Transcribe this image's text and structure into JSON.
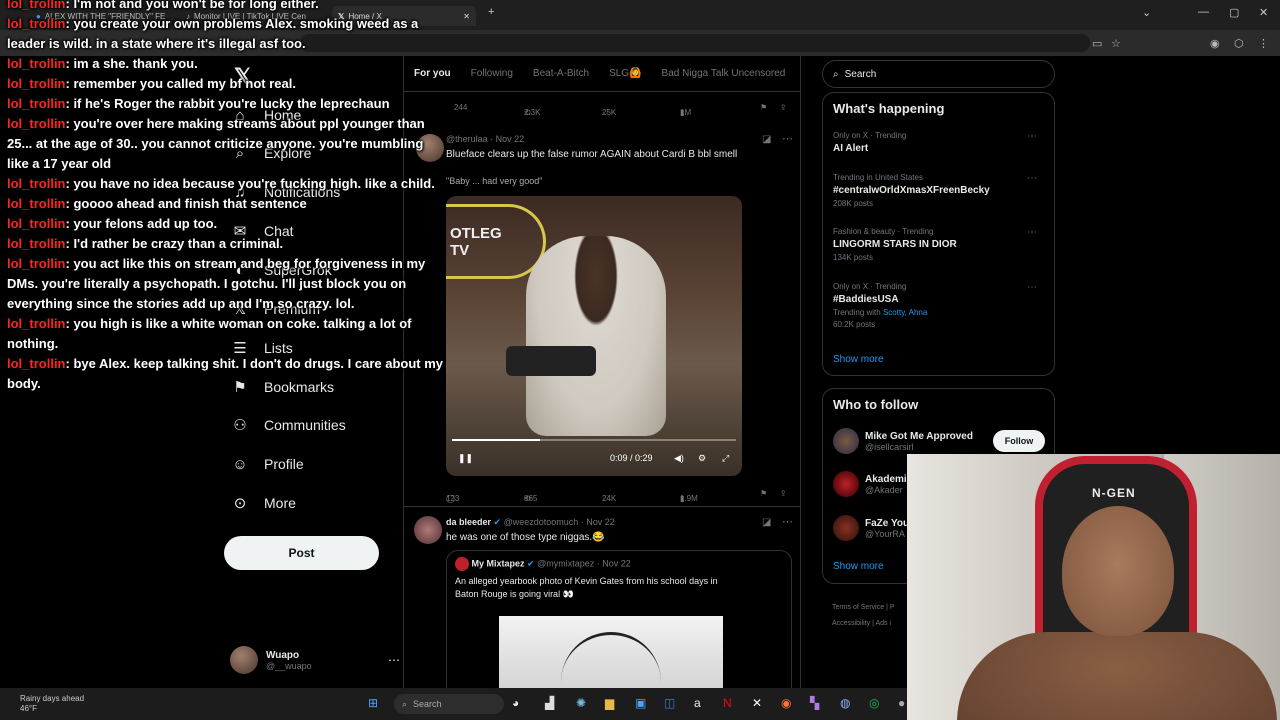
{
  "browser": {
    "tabs": [
      {
        "label": "ALEX WITH THE \"FRIENDLY\" FE"
      },
      {
        "label": "Monitor LIVE | TikTok LIVE Cen"
      },
      {
        "label": "Home / X"
      }
    ],
    "new_tab": "+",
    "window_controls": {
      "minimize": "—",
      "maximize": "▢",
      "close": "✕"
    }
  },
  "nav": {
    "items": [
      {
        "label": "Home",
        "icon": "home-icon"
      },
      {
        "label": "Explore",
        "icon": "search-icon"
      },
      {
        "label": "Notifications",
        "icon": "bell-icon"
      },
      {
        "label": "Chat",
        "icon": "mail-icon"
      },
      {
        "label": "SuperGrok",
        "icon": "grok-icon"
      },
      {
        "label": "Premium",
        "icon": "x-icon"
      },
      {
        "label": "Lists",
        "icon": "list-icon"
      },
      {
        "label": "Bookmarks",
        "icon": "bookmark-icon"
      },
      {
        "label": "Communities",
        "icon": "people-icon"
      },
      {
        "label": "Profile",
        "icon": "person-icon"
      },
      {
        "label": "More",
        "icon": "more-circle-icon"
      }
    ],
    "post_label": "Post",
    "account": {
      "name": "Wuapo",
      "handle": "@__wuapo"
    }
  },
  "feed": {
    "tabs": [
      "For you",
      "Following",
      "Beat-A-Bitch",
      "SLG🙆",
      "Bad Nigga Talk Uncensored"
    ],
    "prev_actions": {
      "replies": "244",
      "reposts": "2.3K",
      "likes": "25K",
      "views": "1M"
    },
    "tweet1": {
      "meta": "Nov 22",
      "handle": "@therulaa",
      "text": "Blueface clears up the false rumor AGAIN about Cardi B bbl smell",
      "subtext": "\"Baby ... had very good\"",
      "video_sign": "OTLEG",
      "video_sign2": "TV",
      "time": "0:09 / 0:29",
      "progress": 0.31,
      "actions": {
        "replies": "123",
        "reposts": "865",
        "likes": "24K",
        "views": "1.9M"
      }
    },
    "tweet2": {
      "name": "da bleeder",
      "handle": "@weezdotoomuch",
      "date": "Nov 22",
      "text": "he was one of those type niggas.😂",
      "quote": {
        "name": "My Mixtapez",
        "handle": "@mymixtapez",
        "date": "Nov 22",
        "text1": "An alleged yearbook photo of Kevin Gates from his school days in",
        "text2": "Baton Rouge is going viral 👀"
      }
    }
  },
  "right": {
    "search_placeholder": "Search",
    "happening_title": "What's happening",
    "trends": [
      {
        "context": "Only on X · Trending",
        "name": "AI Alert",
        "count": ""
      },
      {
        "context": "Trending in United States",
        "name": "#centralwOrldXmasXFreenBecky",
        "count": "208K posts"
      },
      {
        "context": "Fashion & beauty · Trending",
        "name": "LINGORM STARS IN DIOR",
        "count": "134K posts"
      },
      {
        "context": "Only on X · Trending",
        "name": "#BaddiesUSA",
        "count": "60.2K posts",
        "with": "Trending with",
        "with_names": "Scotty, Ahna"
      }
    ],
    "show_more": "Show more",
    "who_title": "Who to follow",
    "who": [
      {
        "name": "Mike Got Me Approved",
        "handle": "@isellcarsirl",
        "follow": "Follow"
      },
      {
        "name": "Akademi",
        "handle": "@Akader"
      },
      {
        "name": "FaZe You",
        "handle": "@YourRA"
      }
    ],
    "show_more2": "Show more",
    "footer1": "Terms of Service  |  P",
    "footer2": "Accessibility  |  Ads i"
  },
  "chat": [
    {
      "user": "lol_trollin",
      "text": ": I'm not and you won't be for long either."
    },
    {
      "user": "lol_trollin",
      "text": ": you create your own problems Alex. smoking weed as a"
    },
    {
      "user": "",
      "text": "leader is wild. in a state where it's illegal asf too."
    },
    {
      "user": "lol_trollin",
      "text": ": im a she. thank you."
    },
    {
      "user": "lol_trollin",
      "text": ": remember you called my bf not real."
    },
    {
      "user": "lol_trollin",
      "text": ": if he's Roger the rabbit you're lucky the leprechaun"
    },
    {
      "user": "lol_trollin",
      "text": ": you're over here making streams about ppl younger than"
    },
    {
      "user": "",
      "text": "25... at the age of 30.. you cannot criticize anyone. you're mumbling"
    },
    {
      "user": "",
      "text": "like a 17 year old"
    },
    {
      "user": "lol_trollin",
      "text": ": you have no idea because you're fucking high. like a child."
    },
    {
      "user": "lol_trollin",
      "text": ": goooo ahead and finish that sentence"
    },
    {
      "user": "lol_trollin",
      "text": ": your felons add up too."
    },
    {
      "user": "lol_trollin",
      "text": ": I'd rather be crazy than a criminal."
    },
    {
      "user": "lol_trollin",
      "text": ": you act like this on stream and beg for forgiveness in my"
    },
    {
      "user": "",
      "text": "DMs. you're literally a psychopath. I gotchu. I'll just block you on"
    },
    {
      "user": "",
      "text": "everything since the stories add up and I'm so crazy. lol."
    },
    {
      "user": "lol_trollin",
      "text": ": you high is like a white woman on coke. talking a lot of"
    },
    {
      "user": "",
      "text": "nothing."
    },
    {
      "user": "lol_trollin",
      "text": ": bye Alex. keep talking shit. I don't do drugs. I care about my"
    },
    {
      "user": "",
      "text": "body."
    }
  ],
  "webcam": {
    "chair_brand": "N-GEN"
  },
  "taskbar": {
    "weather": "Rainy days ahead",
    "temp": "46°F",
    "search": "Search"
  },
  "colors": {
    "accent": "#1d9bf0",
    "chat_user": "#ff2424",
    "chair": "#c02030"
  }
}
